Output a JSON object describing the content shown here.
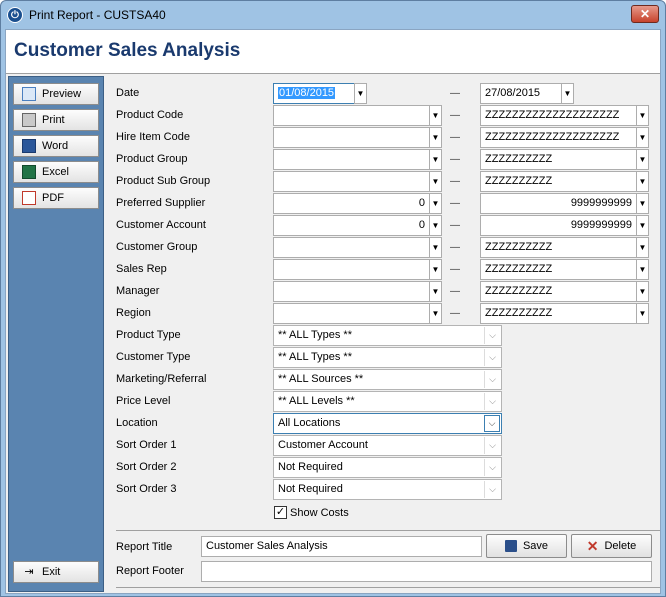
{
  "window": {
    "title": "Print Report - CUSTSA40",
    "close": "✕"
  },
  "header": {
    "title": "Customer Sales Analysis"
  },
  "sidebar": {
    "buttons": [
      {
        "label": "Preview",
        "icon": "preview-icon"
      },
      {
        "label": "Print",
        "icon": "printer-icon"
      },
      {
        "label": "Word",
        "icon": "word-icon"
      },
      {
        "label": "Excel",
        "icon": "excel-icon"
      },
      {
        "label": "PDF",
        "icon": "pdf-icon"
      }
    ],
    "exit_label": "Exit"
  },
  "filters": {
    "date": {
      "label": "Date",
      "from": "01/08/2015",
      "to": "27/08/2015"
    },
    "product_code": {
      "label": "Product Code",
      "from": "",
      "to": "ZZZZZZZZZZZZZZZZZZZZ"
    },
    "hire_item_code": {
      "label": "Hire Item Code",
      "from": "",
      "to": "ZZZZZZZZZZZZZZZZZZZZ"
    },
    "product_group": {
      "label": "Product Group",
      "from": "",
      "to": "ZZZZZZZZZZ"
    },
    "product_sub_group": {
      "label": "Product Sub Group",
      "from": "",
      "to": "ZZZZZZZZZZ"
    },
    "preferred_supplier": {
      "label": "Preferred Supplier",
      "from": "0",
      "to": "9999999999"
    },
    "customer_account": {
      "label": "Customer Account",
      "from": "0",
      "to": "9999999999"
    },
    "customer_group": {
      "label": "Customer Group",
      "from": "",
      "to": "ZZZZZZZZZZ"
    },
    "sales_rep": {
      "label": "Sales Rep",
      "from": "",
      "to": "ZZZZZZZZZZ"
    },
    "manager": {
      "label": "Manager",
      "from": "",
      "to": "ZZZZZZZZZZ"
    },
    "region": {
      "label": "Region",
      "from": "",
      "to": "ZZZZZZZZZZ"
    },
    "range_separator": "—"
  },
  "options": {
    "product_type": {
      "label": "Product Type",
      "value": "** ALL Types **"
    },
    "customer_type": {
      "label": "Customer Type",
      "value": "** ALL Types **"
    },
    "marketing": {
      "label": "Marketing/Referral",
      "value": "** ALL Sources **"
    },
    "price_level": {
      "label": "Price Level",
      "value": "** ALL Levels **"
    },
    "location": {
      "label": "Location",
      "value": "All Locations"
    },
    "sort1": {
      "label": "Sort Order 1",
      "value": "Customer Account"
    },
    "sort2": {
      "label": "Sort Order 2",
      "value": "Not Required"
    },
    "sort3": {
      "label": "Sort Order 3",
      "value": "Not Required"
    },
    "show_costs": {
      "label": "Show Costs",
      "checked": true
    }
  },
  "footer": {
    "report_title_label": "Report Title",
    "report_title_value": "Customer Sales Analysis",
    "report_footer_label": "Report Footer",
    "report_footer_value": "",
    "save_label": "Save",
    "delete_label": "Delete"
  }
}
